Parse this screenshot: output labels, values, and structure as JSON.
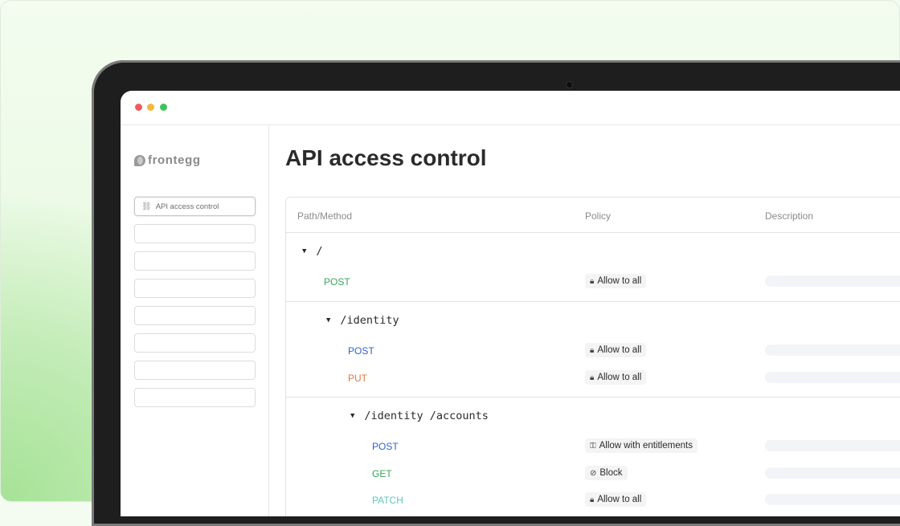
{
  "window": {
    "controls": [
      "close",
      "minimize",
      "maximize"
    ]
  },
  "sidebar": {
    "logo_text": "frontegg",
    "items": [
      {
        "label": "API access control",
        "icon": "api-icon",
        "active": true
      },
      {
        "label": ""
      },
      {
        "label": ""
      },
      {
        "label": ""
      },
      {
        "label": ""
      },
      {
        "label": ""
      },
      {
        "label": ""
      },
      {
        "label": ""
      }
    ]
  },
  "main": {
    "title": "API access control",
    "table": {
      "headers": [
        "Path/Method",
        "Policy",
        "Description"
      ],
      "groups": [
        {
          "path": "/",
          "rows": [
            {
              "method": "POST",
              "policy": "Allow to all",
              "policy_icon": "lock-icon"
            }
          ]
        },
        {
          "path": "/identity",
          "rows": [
            {
              "method": "POST",
              "policy": "Allow to all",
              "policy_icon": "lock-icon"
            },
            {
              "method": "PUT",
              "policy": "Allow to all",
              "policy_icon": "lock-icon"
            }
          ]
        },
        {
          "path": "/identity /accounts",
          "rows": [
            {
              "method": "POST",
              "policy": "Allow with entitlements",
              "policy_icon": "key-icon"
            },
            {
              "method": "GET",
              "policy": "Block",
              "policy_icon": "block-icon"
            },
            {
              "method": "PATCH",
              "policy": "Allow to all",
              "policy_icon": "lock-icon"
            }
          ]
        }
      ]
    }
  },
  "colors": {
    "post_root": "#3aa45b",
    "post": "#2f62c9",
    "put": "#e27840",
    "get": "#3aa45b",
    "patch": "#5fc7bd"
  }
}
